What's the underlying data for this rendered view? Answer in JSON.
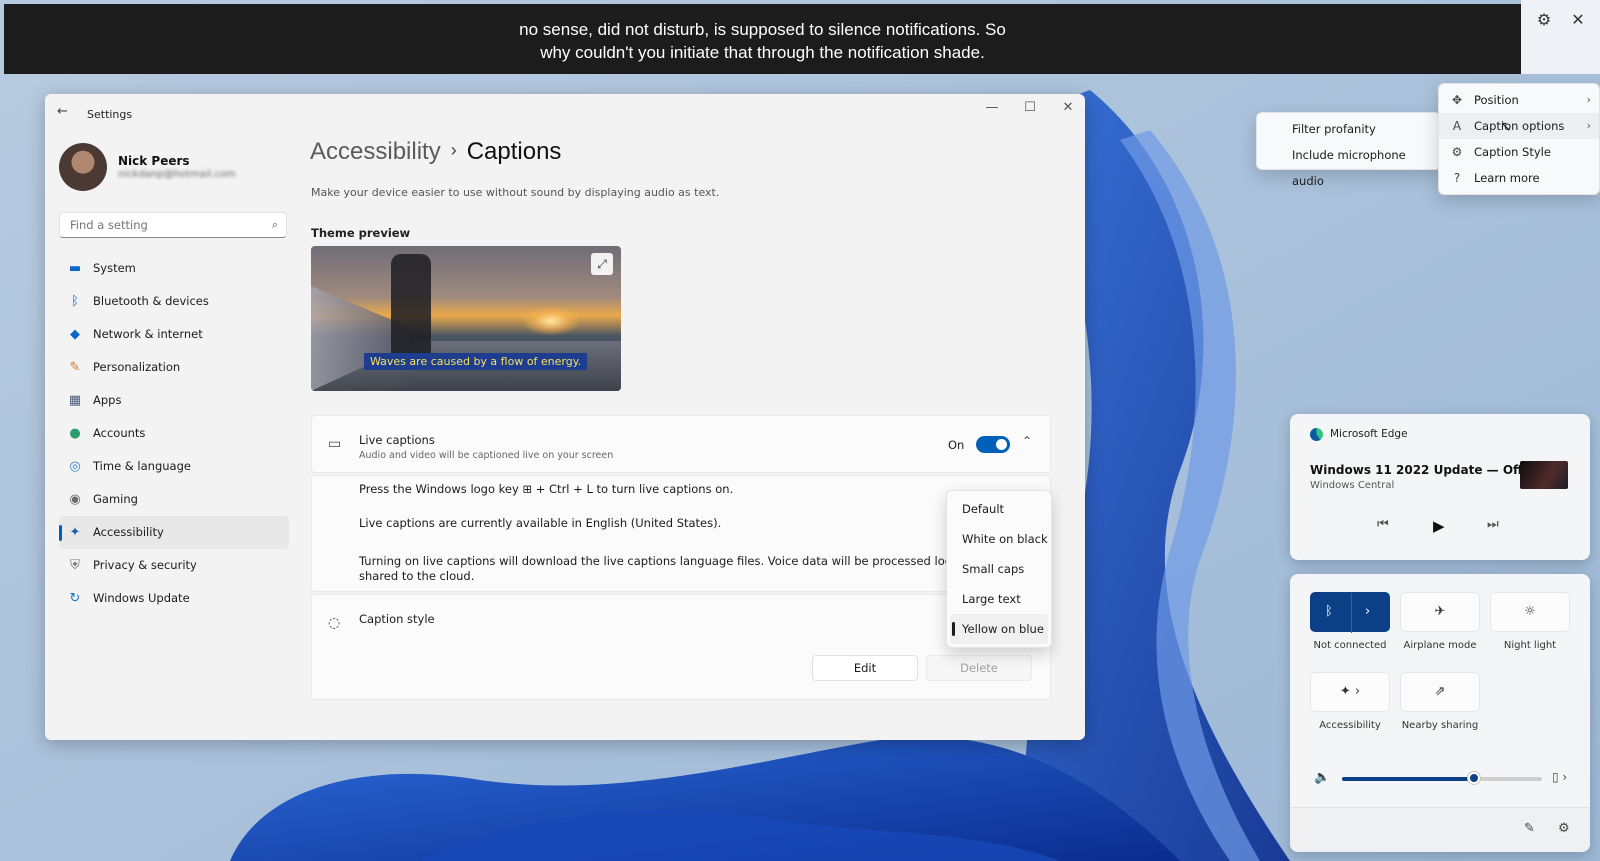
{
  "caption_bar": {
    "lines": [
      "no sense, did not disturb, is supposed to silence notifications. So",
      "why couldn't you initiate that through the notification shade."
    ],
    "settings_icon": "gear-icon",
    "close_icon": "close-icon"
  },
  "caption_menu": {
    "items": [
      {
        "icon": "move-icon",
        "label": "Position",
        "chevron": "›"
      },
      {
        "icon": "caption-options-icon",
        "label": "Caption options",
        "chevron": "›"
      },
      {
        "icon": "gear-icon",
        "label": "Caption Style"
      },
      {
        "icon": "help-icon",
        "label": "Learn more"
      }
    ],
    "submenu": [
      "Filter profanity",
      "Include microphone audio"
    ]
  },
  "window": {
    "app_title": "Settings",
    "profile": {
      "name": "Nick Peers",
      "email": "nickdanp@hotmail.com"
    },
    "search": {
      "placeholder": "Find a setting"
    },
    "nav": [
      {
        "label": "System",
        "icon": "system-icon",
        "color": "#0a66c8"
      },
      {
        "label": "Bluetooth & devices",
        "icon": "bluetooth-icon",
        "color": "#0a66c8"
      },
      {
        "label": "Network & internet",
        "icon": "wifi-icon",
        "color": "#0a66c8"
      },
      {
        "label": "Personalization",
        "icon": "brush-icon",
        "color": "#d07a2a"
      },
      {
        "label": "Apps",
        "icon": "apps-icon",
        "color": "#4a5b7c"
      },
      {
        "label": "Accounts",
        "icon": "person-icon",
        "color": "#2e9b6b"
      },
      {
        "label": "Time & language",
        "icon": "globe-clock-icon",
        "color": "#2b7fd3"
      },
      {
        "label": "Gaming",
        "icon": "gamepad-icon",
        "color": "#6b6b6b"
      },
      {
        "label": "Accessibility",
        "icon": "accessibility-icon",
        "color": "#1a5fb4"
      },
      {
        "label": "Privacy & security",
        "icon": "shield-icon",
        "color": "#6f6f6f"
      },
      {
        "label": "Windows Update",
        "icon": "update-icon",
        "color": "#1a73c8"
      }
    ],
    "active_nav": "Accessibility",
    "breadcrumb": {
      "parent": "Accessibility",
      "separator": "›",
      "current": "Captions"
    },
    "description": "Make your device easier to use without sound by displaying audio as text.",
    "theme_preview": {
      "label": "Theme preview",
      "sample_text": "Waves are caused by a flow of energy."
    },
    "live_captions": {
      "title": "Live captions",
      "subtitle": "Audio and video will be captioned live on your screen",
      "toggle_label": "On",
      "toggle_on": true,
      "lines": [
        "Press the Windows logo key ⊞ + Ctrl + L to turn live captions on.",
        "Live captions are currently available in English (United States).",
        "Turning on live captions will download the live captions language files. Voice data will be processed locally and y",
        "shared to the cloud."
      ]
    },
    "caption_style": {
      "title": "Caption style",
      "edit_label": "Edit",
      "delete_label": "Delete",
      "options": [
        "Default",
        "White on black",
        "Small caps",
        "Large text",
        "Yellow on blue"
      ],
      "selected": "Yellow on blue"
    }
  },
  "media": {
    "app": "Microsoft Edge",
    "title": "Windows 11 2022 Update — Official...",
    "channel": "Windows Central"
  },
  "quick_settings": {
    "tiles": [
      {
        "label": "Not connected",
        "icon": "bluetooth-icon",
        "active": true
      },
      {
        "label": "Airplane mode",
        "icon": "airplane-icon",
        "active": false
      },
      {
        "label": "Night light",
        "icon": "brightness-icon",
        "active": false
      },
      {
        "label": "Accessibility",
        "icon": "accessibility-icon",
        "active": false
      },
      {
        "label": "Nearby sharing",
        "icon": "share-icon",
        "active": false
      }
    ],
    "volume_percent": 66,
    "accent": "#0b3f86"
  }
}
